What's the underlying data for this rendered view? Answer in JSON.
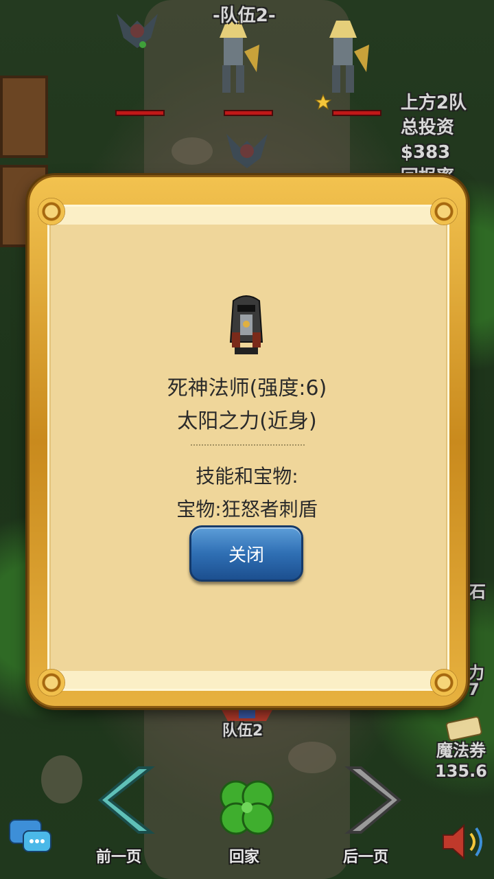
{
  "battlefield": {
    "team_top_label": "-队伍2-",
    "side_info": [
      "上方2队",
      "总投资",
      "$383",
      "回报率"
    ],
    "team_bottom_label": "队伍2",
    "voucher_label": "魔法券",
    "voucher_value": "135.6",
    "partial_right_1": "石",
    "partial_right_2": "力",
    "partial_right_3": "7"
  },
  "dialog": {
    "unit_name": "死神法师(强度:6)",
    "unit_skill": "太阳之力(近身)",
    "section_title": "技能和宝物:",
    "treasure": "宝物:狂怒者刺盾",
    "close_label": "关闭"
  },
  "nav": {
    "prev_label": "前一页",
    "home_label": "回家",
    "next_label": "后一页"
  },
  "icons": {
    "prev": "chevron-left-icon",
    "home": "clover-icon",
    "next": "chevron-right-icon",
    "chat": "chat-icon",
    "sound": "sound-icon"
  },
  "colors": {
    "hp_bar": "#c01818",
    "dialog_frame": "#e0a838",
    "parchment": "#efd69a",
    "close_button": "#2f6fb4"
  }
}
